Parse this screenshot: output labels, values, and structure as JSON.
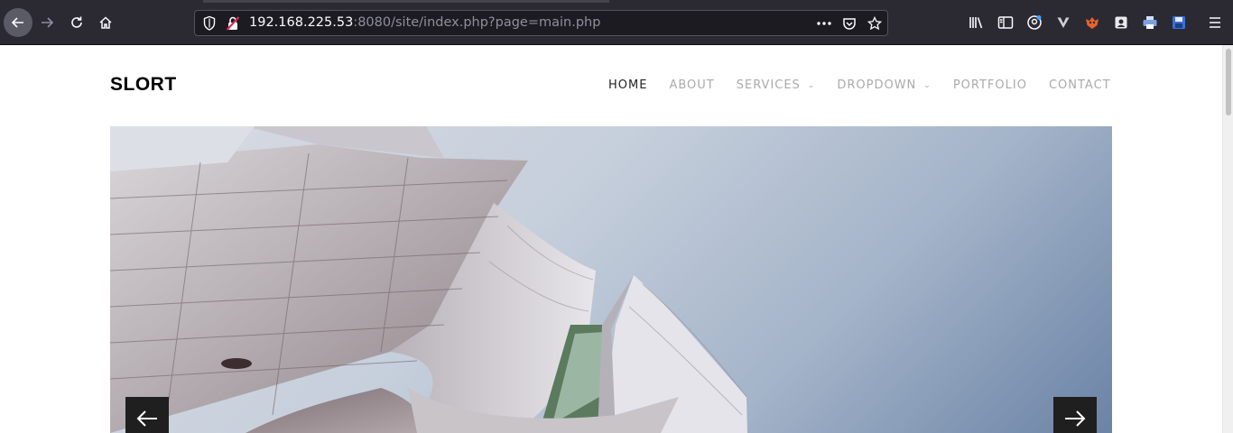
{
  "browser": {
    "url_host": "192.168.225.53",
    "url_rest": ":8080/site/index.php?page=main.php",
    "icons": {
      "back": "back-arrow-icon",
      "forward": "forward-arrow-icon",
      "reload": "reload-icon",
      "home": "home-icon",
      "shield": "tracking-shield-icon",
      "lock": "insecure-lock-icon",
      "more": "more-actions-icon",
      "pocket": "pocket-icon",
      "star": "bookmark-star-icon",
      "library": "library-icon",
      "sidebar": "sidebar-icon",
      "account": "account-icon",
      "extension1": "vpn-extension-icon",
      "extension2": "fox-extension-icon",
      "extension3": "cookie-extension-icon",
      "extension4": "printer-extension-icon",
      "extension5": "save-extension-icon",
      "menu": "hamburger-menu-icon"
    }
  },
  "site": {
    "logo": "SLORT",
    "nav": [
      {
        "label": "HOME",
        "active": true,
        "dropdown": false
      },
      {
        "label": "ABOUT",
        "active": false,
        "dropdown": false
      },
      {
        "label": "SERVICES",
        "active": false,
        "dropdown": true
      },
      {
        "label": "DROPDOWN",
        "active": false,
        "dropdown": true
      },
      {
        "label": "PORTFOLIO",
        "active": false,
        "dropdown": false
      },
      {
        "label": "CONTACT",
        "active": false,
        "dropdown": false
      }
    ],
    "slider": {
      "prev_icon": "arrow-left-icon",
      "next_icon": "arrow-right-icon"
    }
  },
  "colors": {
    "toolbar": "#2b2a33",
    "urlbar": "#1c1b22",
    "nav_active": "#222222",
    "nav_inactive": "#aaaaaa",
    "slider_button": "#1f1f1f"
  }
}
